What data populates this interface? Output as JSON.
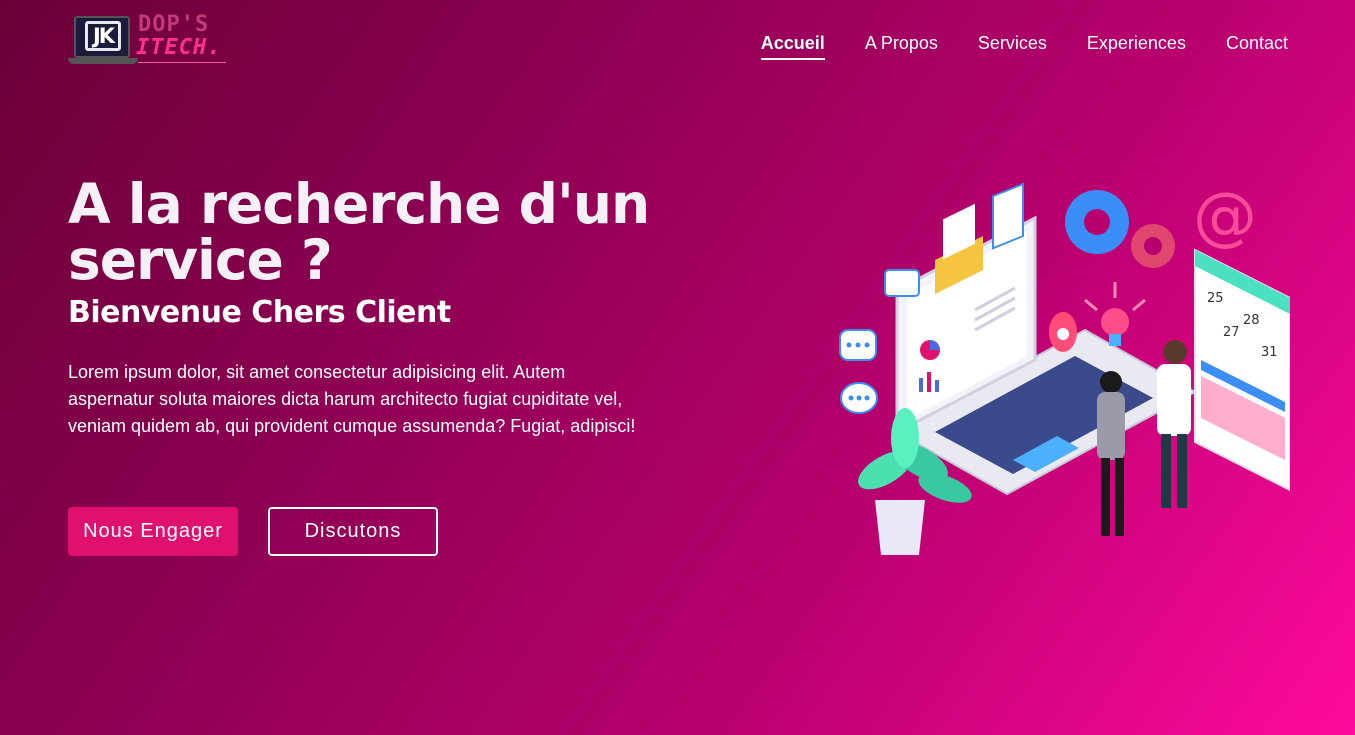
{
  "logo": {
    "monogram": "JK",
    "word_top": "DOP'S",
    "word_bottom": "ITECH."
  },
  "nav": {
    "items": [
      {
        "label": "Accueil",
        "active": true
      },
      {
        "label": "A Propos",
        "active": false
      },
      {
        "label": "Services",
        "active": false
      },
      {
        "label": "Experiences",
        "active": false
      },
      {
        "label": "Contact",
        "active": false
      }
    ]
  },
  "hero": {
    "title": "A la recherche d'un service ?",
    "subtitle": "Bienvenue Chers Client",
    "text": "Lorem ipsum dolor, sit amet consectetur adipisicing elit. Autem aspernatur soluta maiores dicta harum architecto fugiat cupiditate vel, veniam quidem ab, qui provident cumque assumenda? Fugiat, adipisci!",
    "primary_button": "Nous Engager",
    "secondary_button": "Discutons"
  },
  "illustration": {
    "calendar_numbers": [
      "25",
      "28",
      "27",
      "31"
    ],
    "at_symbol": "@"
  },
  "colors": {
    "gradient_start": "#6a0038",
    "gradient_end": "#ff0a9c",
    "accent": "#e0106e",
    "logo_pink": "#ff2f8f"
  },
  "icons": [
    "laptop-icon",
    "gear-icon",
    "at-sign-icon",
    "chat-bubble-icon",
    "envelope-icon",
    "lightbulb-icon",
    "plant-icon",
    "calendar-icon"
  ]
}
